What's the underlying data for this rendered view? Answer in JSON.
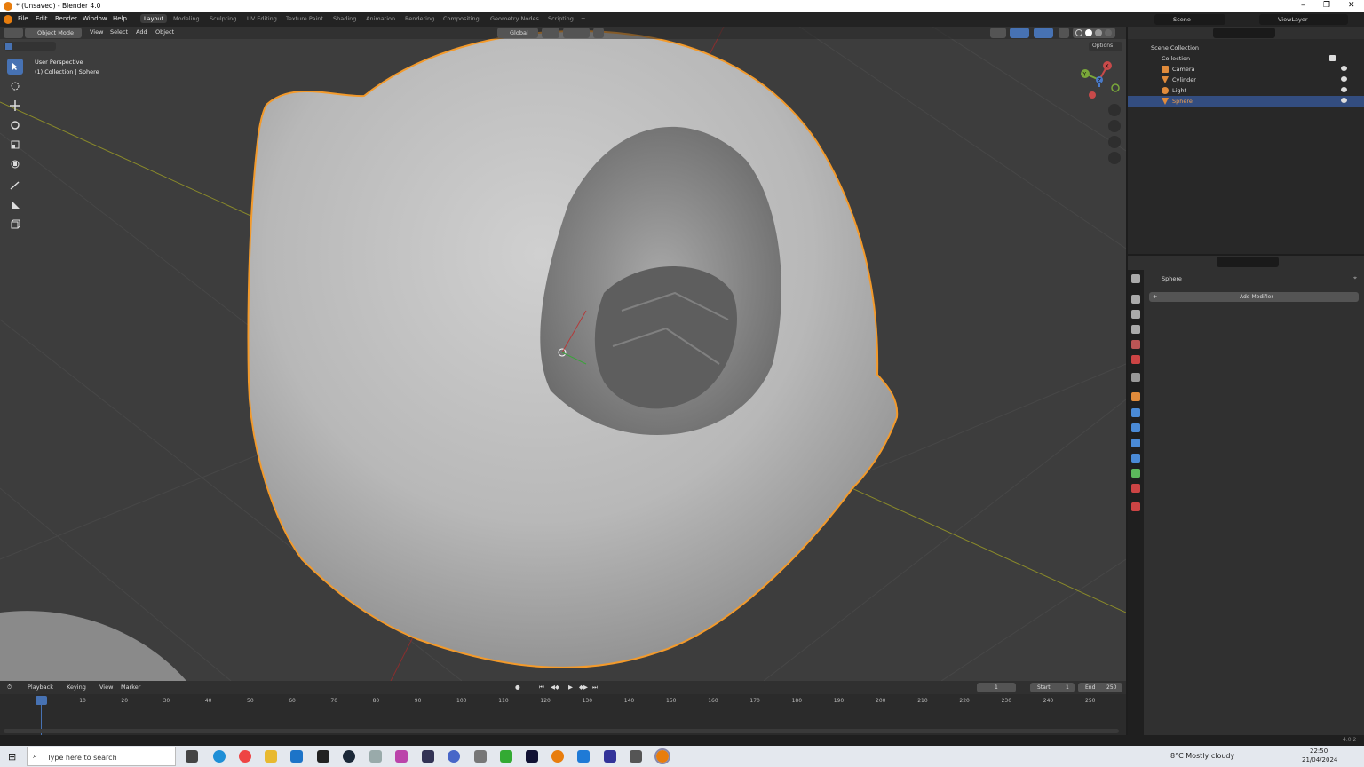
{
  "window": {
    "title": "* (Unsaved) - Blender 4.0",
    "minimize": "–",
    "maximize": "❐",
    "close": "✕"
  },
  "menubar": {
    "items": [
      "File",
      "Edit",
      "Render",
      "Window",
      "Help"
    ],
    "workspaces": [
      "Layout",
      "Modeling",
      "Sculpting",
      "UV Editing",
      "Texture Paint",
      "Shading",
      "Animation",
      "Rendering",
      "Compositing",
      "Geometry Nodes",
      "Scripting"
    ],
    "active_workspace": "Layout",
    "scene": "Scene",
    "view_layer": "ViewLayer"
  },
  "viewport_header": {
    "mode": "Object Mode",
    "menus": [
      "View",
      "Select",
      "Add",
      "Object"
    ],
    "transform_orientation": "Global",
    "options": "Options"
  },
  "viewport_overlay": {
    "view_name": "User Perspective",
    "collection_info": "(1) Collection | Sphere"
  },
  "toolbar": {
    "tools": [
      "select-box-icon",
      "cursor-icon",
      "move-icon",
      "rotate-icon",
      "scale-icon",
      "transform-icon",
      "annotate-icon",
      "measure-icon",
      "add-cube-icon"
    ]
  },
  "gizmo": {
    "x": "X",
    "y": "Y",
    "z": "Z"
  },
  "outliner": {
    "root": "Scene Collection",
    "collection": "Collection",
    "items": [
      {
        "name": "Camera",
        "icon": "camera-icon"
      },
      {
        "name": "Cylinder",
        "icon": "mesh-icon"
      },
      {
        "name": "Light",
        "icon": "light-icon"
      },
      {
        "name": "Sphere",
        "icon": "mesh-icon",
        "selected": true
      }
    ]
  },
  "properties": {
    "object_name": "Sphere",
    "add_modifier": "Add Modifier",
    "plus": "+"
  },
  "timeline": {
    "menus": [
      "Playback",
      "Keying",
      "View",
      "Marker"
    ],
    "current_frame": "1",
    "start_label": "Start",
    "start": "1",
    "end_label": "End",
    "end": "250",
    "ticks": [
      "1",
      "10",
      "20",
      "30",
      "40",
      "50",
      "60",
      "70",
      "80",
      "90",
      "100",
      "110",
      "120",
      "130",
      "140",
      "150",
      "160",
      "170",
      "180",
      "190",
      "200",
      "210",
      "220",
      "230",
      "240",
      "250"
    ]
  },
  "statusbar": {
    "version": "4.0.2"
  },
  "taskbar": {
    "search_placeholder": "Type here to search",
    "weather": "8°C  Mostly cloudy",
    "time": "22:50",
    "date": "21/04/2024"
  },
  "colors": {
    "accent": "#4772b3",
    "selection_outline": "#f39a2b",
    "viewport_bg": "#3d3d3d"
  }
}
